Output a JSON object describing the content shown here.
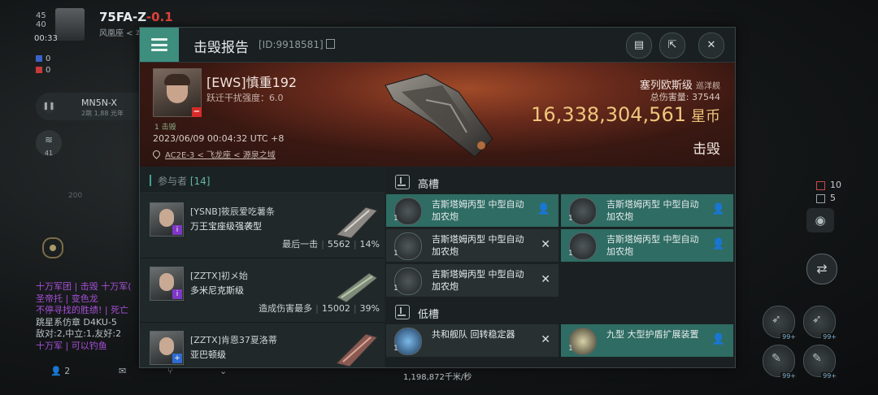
{
  "hud": {
    "top_num1": "45",
    "top_num2": "40",
    "clock": "00:33",
    "system": "75FA-Z",
    "security": "-0.1",
    "region": "风凰座 < 本",
    "stat_blue": "0",
    "stat_red": "0",
    "mn_label": "MN5N-X",
    "mn_sub": "2跳 1,88 光年",
    "chev_num": "41",
    "scale_a": "200",
    "scale_b": "200",
    "chat_line1": "十万军团 | 击毁 十万军(",
    "chat_line2": "圣帝托 | 变色龙",
    "chat_line3": "不停寻找的胜绩! | 死亡",
    "chat_line4": "跳星系仿章 D4KU-5",
    "chat_line5": "敌对:2,中立:1,友好:2",
    "chat_line6": "十万军 | 可以钓鱼",
    "bottom_count": "2",
    "speed": "1,198,872千米/秒",
    "right_red": "10",
    "right_gray": "5",
    "module_pct": "99+",
    "colors": {
      "accent": "#3e8e7e",
      "security": "#e2433b",
      "isk": "#efc57c"
    }
  },
  "panel": {
    "title": "击毁报告",
    "report_id": "[ID:9918581]",
    "victim": {
      "name": "[EWS]慎重192",
      "warp_strength": "跃迁干扰强度：6.0",
      "destroyed_count": "1 击毁",
      "datetime": "2023/06/09 00:04:32 UTC +8",
      "location": "AC2E-3 < 飞龙座 < 源泉之域",
      "ship": "塞列欧斯级",
      "ship_class": "巡洋舰",
      "total_damage": "总伤害量: 37544",
      "isk_value": "16,338,304,561",
      "isk_unit": "星币",
      "status": "击毁"
    },
    "participants_label": "参与者",
    "participants_count": "[14]",
    "attackers": [
      {
        "name": "[YSNB]筱辰爱吃薯条",
        "ship": "万王宝座级强袭型",
        "label": "最后一击",
        "damage": "5562",
        "percent": "14%"
      },
      {
        "name": "[ZZTX]初メ始",
        "ship": "多米尼克斯级",
        "label": "造成伤害最多",
        "damage": "15002",
        "percent": "39%"
      },
      {
        "name": "[ZZTX]肯恩37夏洛蒂",
        "ship": "亚巴顿级",
        "label": "",
        "damage": "",
        "percent": ""
      }
    ],
    "high_slot_label": "高槽",
    "low_slot_label": "低槽",
    "high_slots": [
      {
        "name": "吉斯塔姆丙型 中型自动加农炮",
        "qty": "1",
        "state": "dropped",
        "icon": "person-icon"
      },
      {
        "name": "吉斯塔姆丙型 中型自动加农炮",
        "qty": "1",
        "state": "dropped",
        "icon": "person-icon"
      },
      {
        "name": "吉斯塔姆丙型 中型自动加农炮",
        "qty": "1",
        "state": "destroyed",
        "icon": "x-icon"
      },
      {
        "name": "吉斯塔姆丙型 中型自动加农炮",
        "qty": "1",
        "state": "dropped",
        "icon": "person-icon"
      },
      {
        "name": "吉斯塔姆丙型 中型自动加农炮",
        "qty": "1",
        "state": "destroyed",
        "icon": "x-icon"
      }
    ],
    "low_slots": [
      {
        "name": "共和舰队 回转稳定器",
        "qty": "1",
        "state": "destroyed",
        "icon": "x-icon"
      },
      {
        "name": "九型 大型护盾扩展装置",
        "qty": "1",
        "state": "dropped",
        "icon": "person-icon"
      }
    ]
  }
}
